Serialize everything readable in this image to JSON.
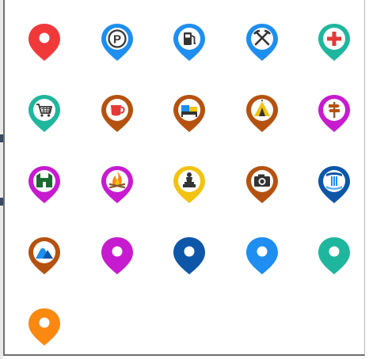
{
  "picker": {
    "markers": [
      {
        "id": "default",
        "color": "#f2393a",
        "icon": "dot",
        "ring": false
      },
      {
        "id": "parking",
        "color": "#1e8ef0",
        "icon": "parking",
        "ring": true
      },
      {
        "id": "gas",
        "color": "#1e8ef0",
        "icon": "gas",
        "ring": true
      },
      {
        "id": "mine",
        "color": "#1e8ef0",
        "icon": "mine",
        "ring": true
      },
      {
        "id": "hospital",
        "color": "#1fb69e",
        "icon": "hospital",
        "ring": true
      },
      {
        "id": "shop",
        "color": "#1fb69e",
        "icon": "cart",
        "ring": true
      },
      {
        "id": "cafe",
        "color": "#b5520f",
        "icon": "cup",
        "ring": true
      },
      {
        "id": "hotel",
        "color": "#b5520f",
        "icon": "bed",
        "ring": true
      },
      {
        "id": "camping",
        "color": "#b5520f",
        "icon": "tent",
        "ring": true
      },
      {
        "id": "trail",
        "color": "#c71bcf",
        "icon": "signpost",
        "ring": true
      },
      {
        "id": "hostel",
        "color": "#c71bcf",
        "icon": "hostel",
        "ring": true
      },
      {
        "id": "campfire",
        "color": "#c71bcf",
        "icon": "fire",
        "ring": true
      },
      {
        "id": "monument",
        "color": "#f2c312",
        "icon": "monument",
        "ring": true
      },
      {
        "id": "viewpoint",
        "color": "#b5520f",
        "icon": "camera",
        "ring": true
      },
      {
        "id": "waterfall",
        "color": "#0d56a8",
        "icon": "waterfall",
        "ring": true
      },
      {
        "id": "peak",
        "color": "#b5520f",
        "icon": "mountain",
        "ring": true
      },
      {
        "id": "magenta",
        "color": "#c71bcf",
        "icon": "dot",
        "ring": false
      },
      {
        "id": "navy",
        "color": "#0d56a8",
        "icon": "dot",
        "ring": false
      },
      {
        "id": "blue",
        "color": "#1e8ef0",
        "icon": "dot",
        "ring": false
      },
      {
        "id": "teal",
        "color": "#1fb69e",
        "icon": "dot",
        "ring": false
      },
      {
        "id": "orange",
        "color": "#fb8810",
        "icon": "dot",
        "ring": false
      }
    ]
  }
}
